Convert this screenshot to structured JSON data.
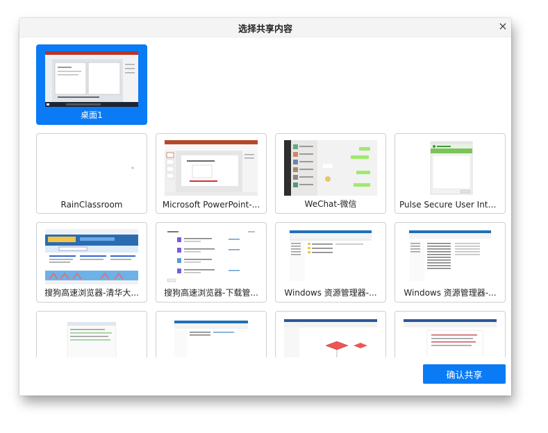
{
  "dialog": {
    "title": "选择共享内容",
    "close_glyph": "×",
    "confirm_label": "确认共享"
  },
  "tiles": [
    {
      "label": "桌面1",
      "selected": true
    },
    {
      "label": "RainClassroom",
      "selected": false
    },
    {
      "label": "Microsoft PowerPoint-...",
      "selected": false
    },
    {
      "label": "WeChat-微信",
      "selected": false
    },
    {
      "label": "Pulse Secure User Inter...",
      "selected": false
    },
    {
      "label": "搜狗高速浏览器-清华大...",
      "selected": false
    },
    {
      "label": "搜狗高速浏览器-下载管...",
      "selected": false
    },
    {
      "label": "Windows 资源管理器-...",
      "selected": false
    },
    {
      "label": "Windows 资源管理器-...",
      "selected": false
    },
    {
      "label": "",
      "selected": false
    },
    {
      "label": "",
      "selected": false
    },
    {
      "label": "",
      "selected": false
    },
    {
      "label": "",
      "selected": false
    }
  ],
  "colors": {
    "accent": "#0a7bf5",
    "title_bar": "#f4f4f4"
  }
}
